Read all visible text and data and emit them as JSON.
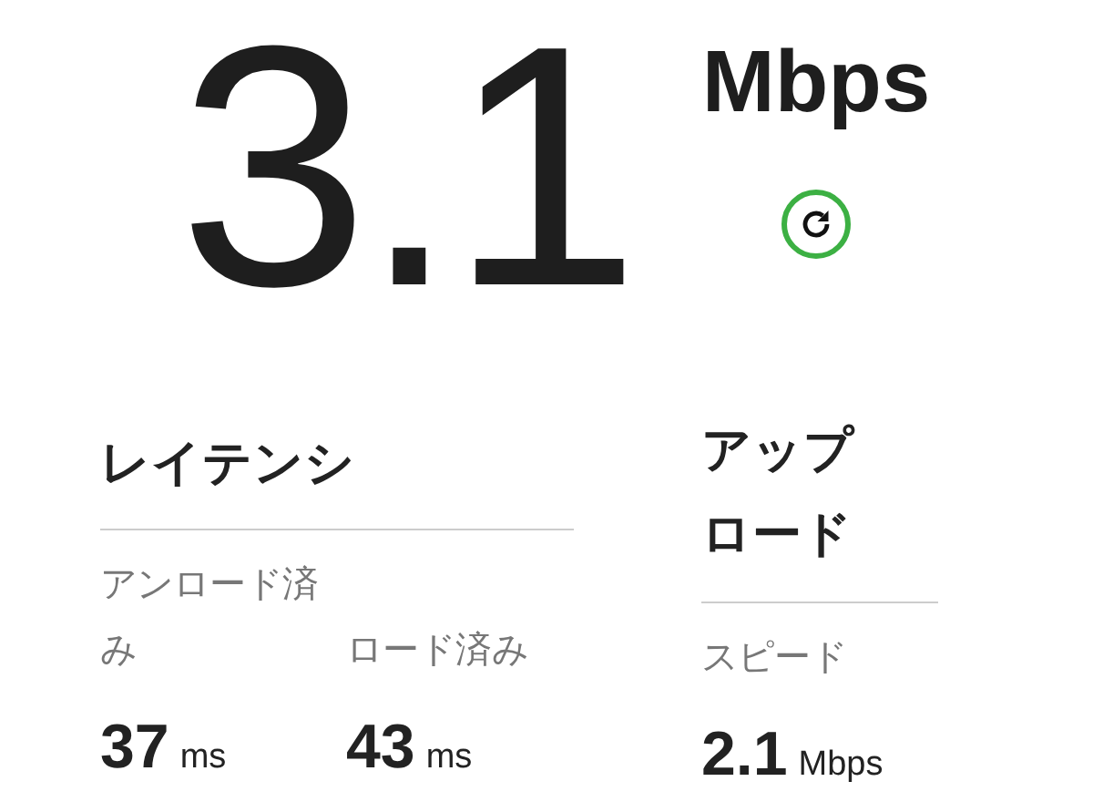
{
  "speed": {
    "value": "3.1",
    "unit": "Mbps"
  },
  "latency": {
    "title": "レイテンシ",
    "items": [
      {
        "label": "アンロード済み",
        "value": "37",
        "unit": "ms"
      },
      {
        "label": "ロード済み",
        "value": "43",
        "unit": "ms"
      }
    ]
  },
  "upload": {
    "title": "アップロード",
    "label": "スピード",
    "value": "2.1",
    "unit": "Mbps"
  }
}
